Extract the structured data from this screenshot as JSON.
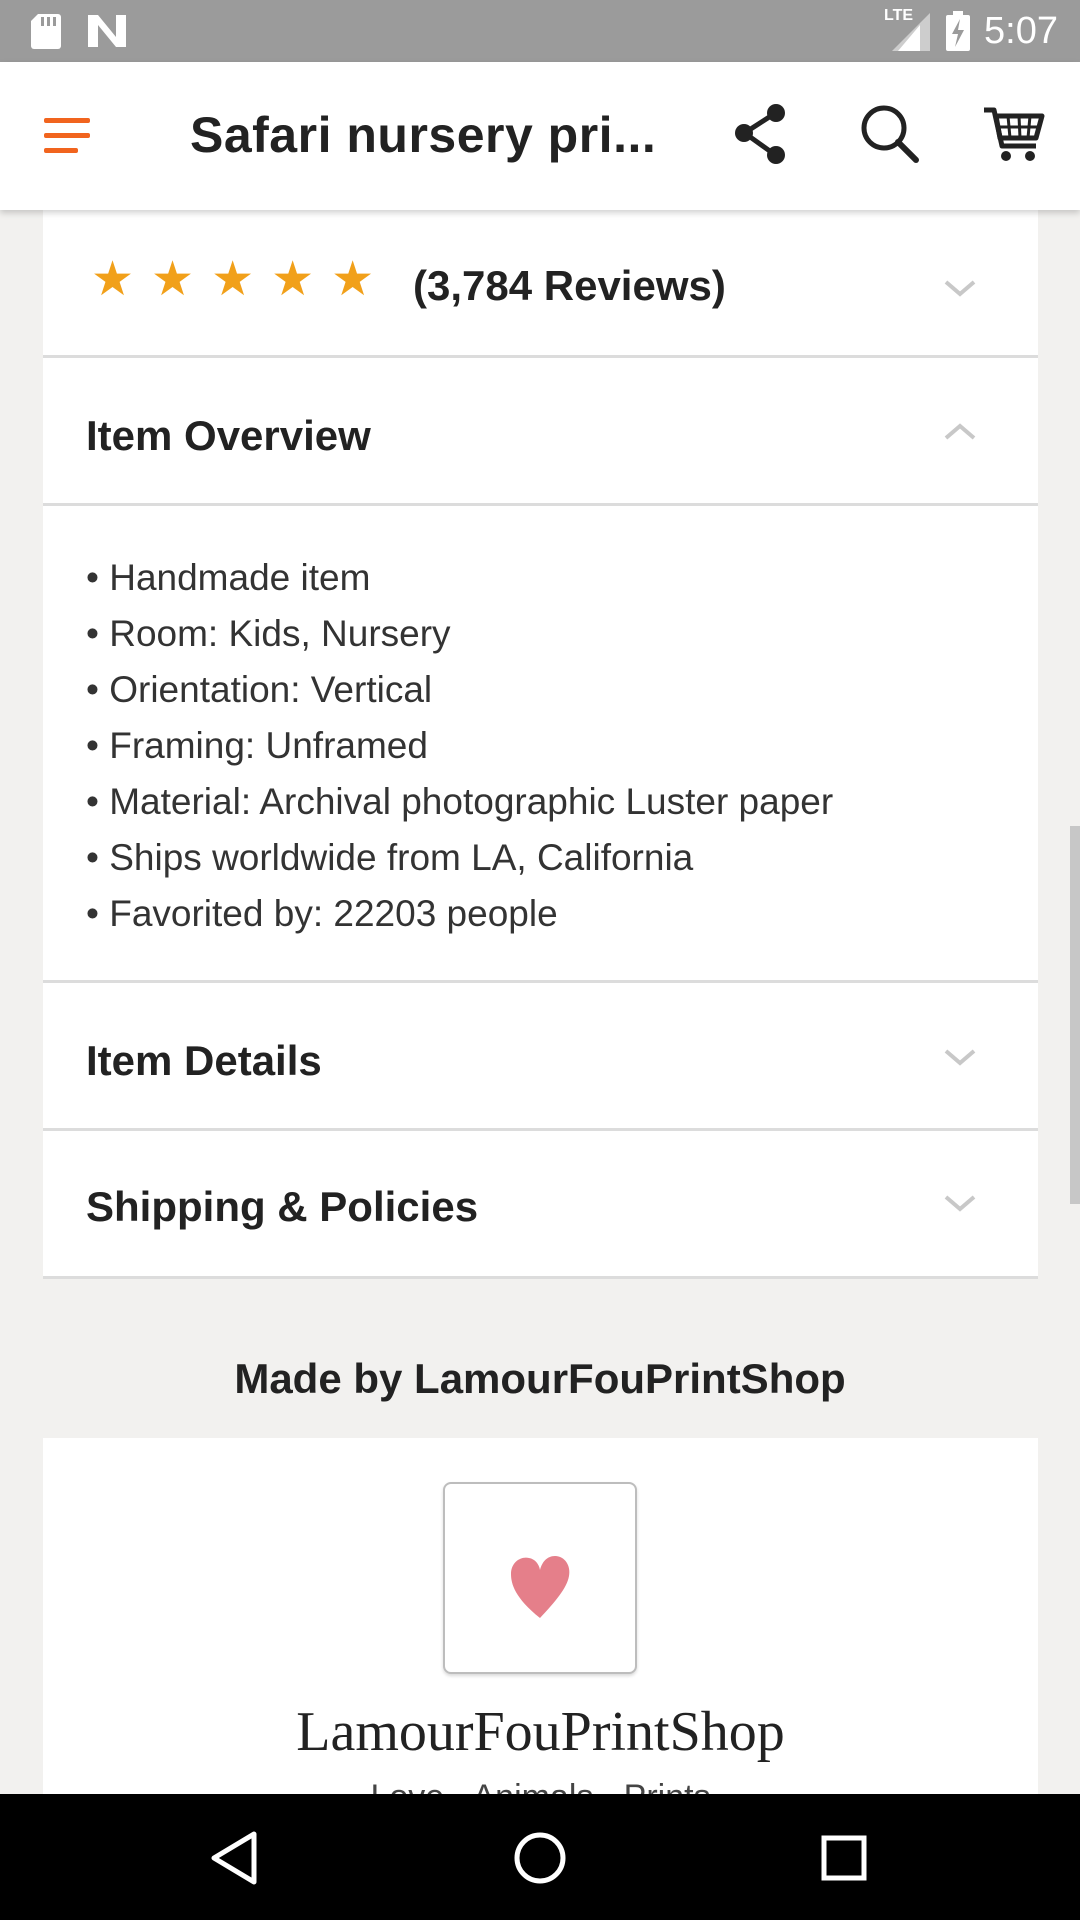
{
  "status_bar": {
    "time": "5:07",
    "network": "LTE",
    "icons": [
      "sd-card-icon",
      "n-notification-icon",
      "signal-icon",
      "battery-charging-icon"
    ]
  },
  "app_bar": {
    "title": "Safari nursery pri...",
    "icons": [
      "menu-icon",
      "share-icon",
      "search-icon",
      "cart-icon"
    ],
    "accent_color": "#f1641e"
  },
  "reviews": {
    "rating": 5,
    "max_rating": 5,
    "label": "(3,784 Reviews)",
    "star_color": "#f1a01a"
  },
  "item_overview": {
    "title": "Item Overview",
    "items": [
      "• Handmade item",
      "• Room: Kids, Nursery",
      "• Orientation: Vertical",
      "• Framing: Unframed",
      "• Material: Archival photographic Luster paper",
      "• Ships worldwide from LA, California",
      "• Favorited by: 22203 people"
    ]
  },
  "item_details": {
    "title": "Item Details"
  },
  "shipping": {
    "title": "Shipping & Policies"
  },
  "made_by": "Made by LamourFouPrintShop",
  "shop": {
    "name": "LamourFouPrintShop",
    "tagline": "Love · Animals · Prints"
  },
  "nav_bar": {
    "icons": [
      "back-icon",
      "home-icon",
      "recents-icon"
    ]
  }
}
